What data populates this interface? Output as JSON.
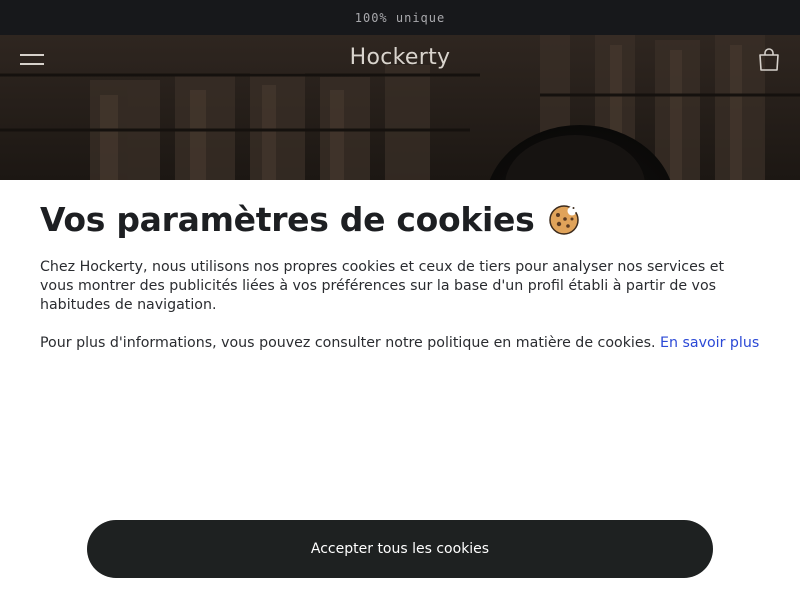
{
  "announcement": {
    "text": "100% unique"
  },
  "header": {
    "logo": "Hockerty",
    "menu_icon": "hamburger-icon",
    "cart_icon": "shopping-bag-icon"
  },
  "cookie_banner": {
    "title": "Vos paramètres de cookies",
    "title_icon": "cookie-icon",
    "paragraph_1": "Chez Hockerty, nous utilisons nos propres cookies et ceux de tiers pour analyser nos services et vous montrer des publicités liées à vos préférences sur la base d'un profil établi à partir de vos habitudes de navigation.",
    "paragraph_2": "Pour plus d'informations, vous pouvez consulter notre politique en matière de cookies.",
    "learn_more_link": "En savoir plus",
    "accept_button": "Accepter tous les cookies"
  },
  "colors": {
    "announcement_bg": "#17181b",
    "button_bg": "#1e2121",
    "link": "#2b49d6"
  }
}
